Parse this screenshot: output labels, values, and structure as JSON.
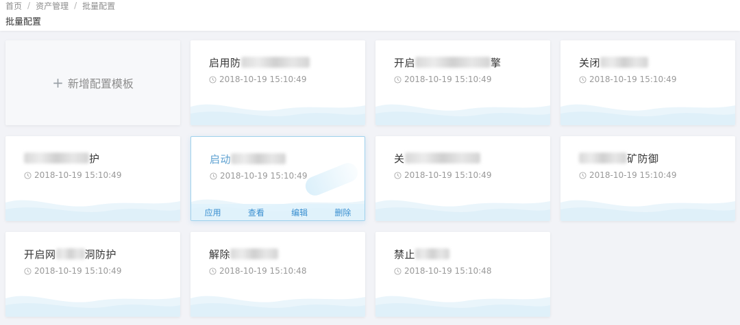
{
  "breadcrumb": [
    "首页",
    "资产管理",
    "批量配置"
  ],
  "page_title": "批量配置",
  "add_card": {
    "label": "新增配置模板"
  },
  "actions": [
    "应用",
    "查看",
    "编辑",
    "删除"
  ],
  "cards": [
    {
      "prefix": "启用防",
      "suffix": "",
      "time": "2018-10-19 15:10:49"
    },
    {
      "prefix": "开启",
      "suffix": "擎",
      "time": "2018-10-19 15:10:49"
    },
    {
      "prefix": "关闭",
      "suffix": "",
      "time": "2018-10-19 15:10:49"
    },
    {
      "prefix": "",
      "suffix": "护",
      "time": "2018-10-19 15:10:49"
    },
    {
      "prefix": "启动",
      "suffix": "",
      "time": "2018-10-19 15:10:49"
    },
    {
      "prefix": "关",
      "suffix": "",
      "time": "2018-10-19 15:10:49"
    },
    {
      "prefix": "",
      "suffix": "矿防御",
      "time": "2018-10-19 15:10:49"
    },
    {
      "prefix": "开启网",
      "suffix": "洞防护",
      "time": "2018-10-19 15:10:49"
    },
    {
      "prefix": "解除",
      "suffix": "",
      "time": "2018-10-19 15:10:48"
    },
    {
      "prefix": "禁止",
      "suffix": "",
      "time": "2018-10-19 15:10:48"
    }
  ]
}
